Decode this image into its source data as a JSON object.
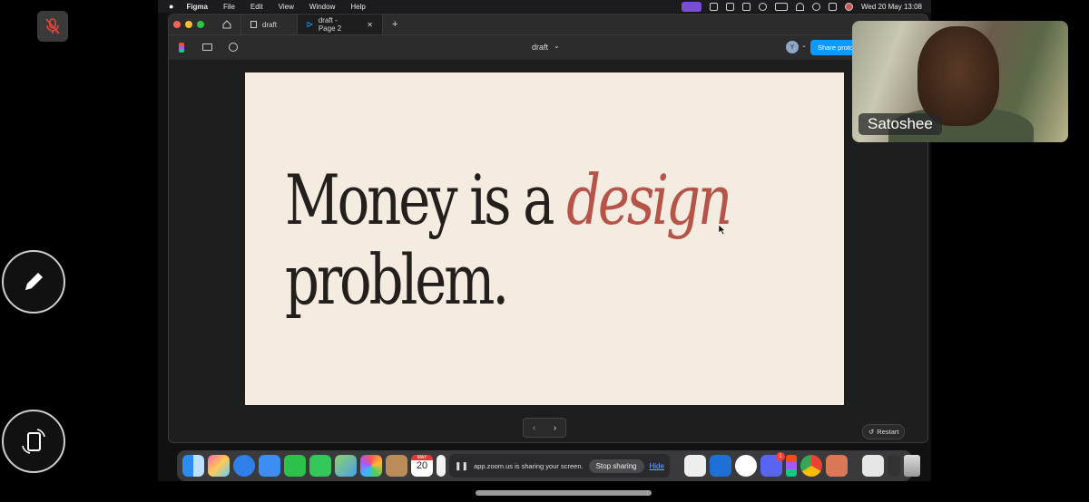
{
  "menubar": {
    "items": [
      "Figma",
      "File",
      "Edit",
      "View",
      "Window",
      "Help"
    ],
    "clock": "Wed 20 May  13:08"
  },
  "figma": {
    "tabs": [
      {
        "label": "draft"
      },
      {
        "label": "draft - Page 2"
      }
    ],
    "file_name": "draft",
    "avatar_initial": "Y",
    "share_label": "Share protot",
    "slide": {
      "line1_plain": "Money is a ",
      "line1_accent": "design",
      "line2": "problem."
    },
    "pager_prev": "‹",
    "pager_next": "›",
    "restart_label": "Restart"
  },
  "dock": {
    "calendar_month": "MAY",
    "calendar_day": "20",
    "sharing_message": "app.zoom.us is sharing your screen.",
    "stop_label": "Stop sharing",
    "hide_label": "Hide",
    "discord_badge": "1"
  },
  "participant": {
    "name": "Satoshee"
  },
  "colors": {
    "slide_bg": "#f4ebe1",
    "headline": "#231f1d",
    "accent": "#b6544a",
    "share_button": "#0d99ff",
    "zoom_menu_chip": "#7a4dd8"
  }
}
